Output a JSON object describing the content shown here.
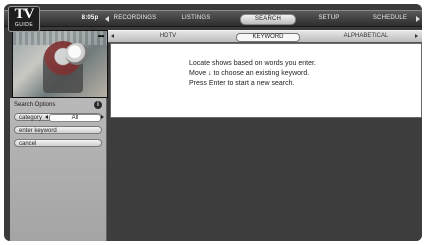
{
  "brand": {
    "logo_line1": "TV",
    "logo_line2": "GUIDE"
  },
  "nav": {
    "items": [
      {
        "label": "8:05p",
        "selected": false
      },
      {
        "label": "RECORDINGS",
        "selected": false
      },
      {
        "label": "LISTINGS",
        "selected": false
      },
      {
        "label": "SEARCH",
        "selected": true
      },
      {
        "label": "SETUP",
        "selected": false
      },
      {
        "label": "SCHEDULE",
        "selected": false
      }
    ]
  },
  "tabs": {
    "items": [
      {
        "label": "HDTV",
        "selected": false
      },
      {
        "label": "KEYWORD",
        "selected": true
      },
      {
        "label": "ALPHABETICAL",
        "selected": false
      }
    ]
  },
  "message": {
    "line1": "Locate shows based on words you enter.",
    "line2": "Move ↓ to choose an existing keyword.",
    "line3": "Press Enter to start a new search."
  },
  "search_options": {
    "title": "Search Options",
    "info_symbol": "i",
    "category_label": "category",
    "category_value": "All",
    "enter_keyword_label": "enter keyword",
    "cancel_label": "cancel"
  },
  "video": {
    "edge_mark": "▬"
  },
  "colors": {
    "screen_bg": "#3a3a3a",
    "panel_bg": "#b0b0b0",
    "content_bg": "#ffffff",
    "highlight": "#efefef"
  }
}
